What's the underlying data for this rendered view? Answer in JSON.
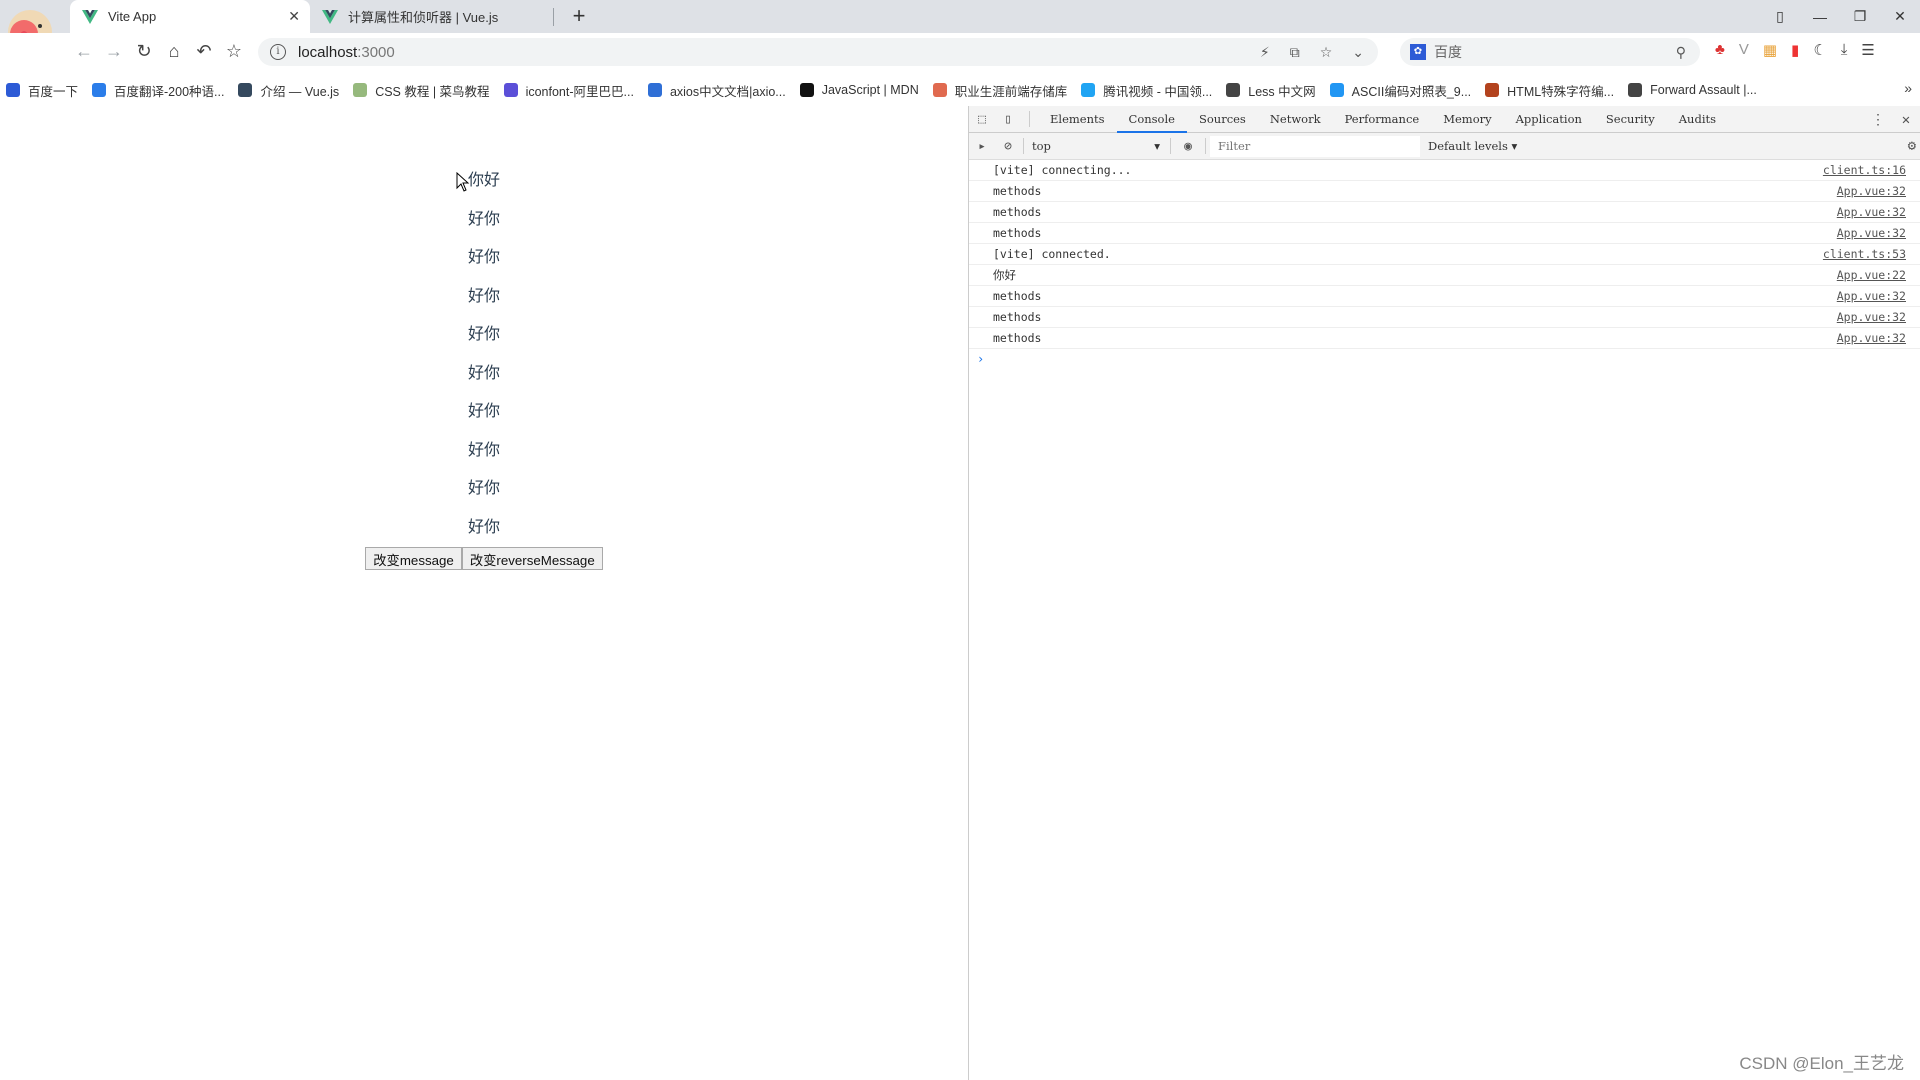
{
  "browser": {
    "tabs": [
      {
        "title": "Vite App",
        "active": true
      },
      {
        "title": "计算属性和侦听器 | Vue.js",
        "active": false
      }
    ],
    "new_tab_label": "+",
    "address": {
      "host": "localhost",
      "port": ":3000"
    },
    "search_engine": {
      "label": "百度"
    },
    "bookmarks": [
      {
        "label": "百度一下",
        "icon": "baidu-paw-icon",
        "color": "#2d5bd6"
      },
      {
        "label": "百度翻译-200种语...",
        "icon": "translate-icon",
        "color": "#2b7de9"
      },
      {
        "label": "介绍 — Vue.js",
        "icon": "vue-icon",
        "color": "#35495e"
      },
      {
        "label": "CSS 教程 | 菜鸟教程",
        "icon": "runoob-icon",
        "color": "#96b97d"
      },
      {
        "label": "iconfont-阿里巴巴...",
        "icon": "iconfont-icon",
        "color": "#5b4fd8"
      },
      {
        "label": "axios中文文档|axio...",
        "icon": "axios-icon",
        "color": "#2f6fd6"
      },
      {
        "label": "JavaScript | MDN",
        "icon": "mdn-icon",
        "color": "#111111"
      },
      {
        "label": "职业生涯前端存储库",
        "icon": "repo-icon",
        "color": "#e06a4f"
      },
      {
        "label": "腾讯视频 - 中国领...",
        "icon": "tencent-video-icon",
        "color": "#20a4f3"
      },
      {
        "label": "Less 中文网",
        "icon": "globe-icon",
        "color": "#444444"
      },
      {
        "label": "ASCII编码对照表_9...",
        "icon": "ascii-icon",
        "color": "#2196f3"
      },
      {
        "label": "HTML特殊字符编...",
        "icon": "html-icon",
        "color": "#b3431e"
      },
      {
        "label": "Forward Assault |...",
        "icon": "globe-icon",
        "color": "#444444"
      }
    ],
    "bookmarks_more": "»"
  },
  "app": {
    "lines": [
      "你好",
      "好你",
      "好你",
      "好你",
      "好你",
      "好你",
      "好你",
      "好你",
      "好你",
      "好你"
    ],
    "buttons": [
      {
        "label": "改变message"
      },
      {
        "label": "改变reverseMessage"
      }
    ]
  },
  "devtools": {
    "tabs": [
      "Elements",
      "Console",
      "Sources",
      "Network",
      "Performance",
      "Memory",
      "Application",
      "Security",
      "Audits"
    ],
    "active_tab": "Console",
    "context": "top",
    "filter_placeholder": "Filter",
    "levels": "Default levels ▾",
    "logs": [
      {
        "message": "[vite] connecting...",
        "source": "client.ts:16"
      },
      {
        "message": "methods",
        "source": "App.vue:32"
      },
      {
        "message": "methods",
        "source": "App.vue:32"
      },
      {
        "message": "methods",
        "source": "App.vue:32"
      },
      {
        "message": "[vite] connected.",
        "source": "client.ts:53"
      },
      {
        "message": "你好",
        "source": "App.vue:22"
      },
      {
        "message": "methods",
        "source": "App.vue:32"
      },
      {
        "message": "methods",
        "source": "App.vue:32"
      },
      {
        "message": "methods",
        "source": "App.vue:32"
      }
    ],
    "prompt": "›"
  },
  "watermark": "CSDN @Elon_王艺龙"
}
